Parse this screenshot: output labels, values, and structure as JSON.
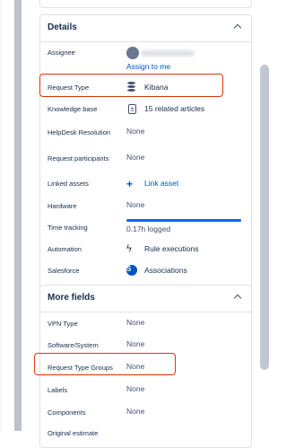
{
  "details": {
    "title": "Details",
    "assignee": {
      "label": "Assignee",
      "assign_to_me": "Assign to me"
    },
    "request_type": {
      "label": "Request Type",
      "value": "Kibana"
    },
    "knowledge_base": {
      "label": "Knowledge base",
      "value": "15 related articles"
    },
    "helpdesk_resolution": {
      "label": "HelpDesk Resolution",
      "value": "None"
    },
    "request_participants": {
      "label": "Request participants",
      "value": "None"
    },
    "linked_assets": {
      "label": "Linked assets",
      "value": "Link asset"
    },
    "hardware": {
      "label": "Hardware",
      "value": "None"
    },
    "time_tracking": {
      "label": "Time tracking",
      "value": "0.17h logged",
      "progress_fraction": 1.0
    },
    "automation": {
      "label": "Automation",
      "value": "Rule executions"
    },
    "salesforce": {
      "label": "Salesforce",
      "value": "Associations"
    }
  },
  "more_fields": {
    "title": "More fields",
    "vpn_type": {
      "label": "VPN Type",
      "value": "None"
    },
    "software_system": {
      "label": "Software/System",
      "value": "None"
    },
    "request_type_groups": {
      "label": "Request Type Groups",
      "value": "None"
    },
    "labels": {
      "label": "Labels",
      "value": "None"
    },
    "components": {
      "label": "Components",
      "value": "None"
    },
    "original_estimate": {
      "label": "Original estimate"
    }
  },
  "colors": {
    "highlight": "#de350b",
    "link": "#0052cc",
    "progress": "#0065ff"
  }
}
